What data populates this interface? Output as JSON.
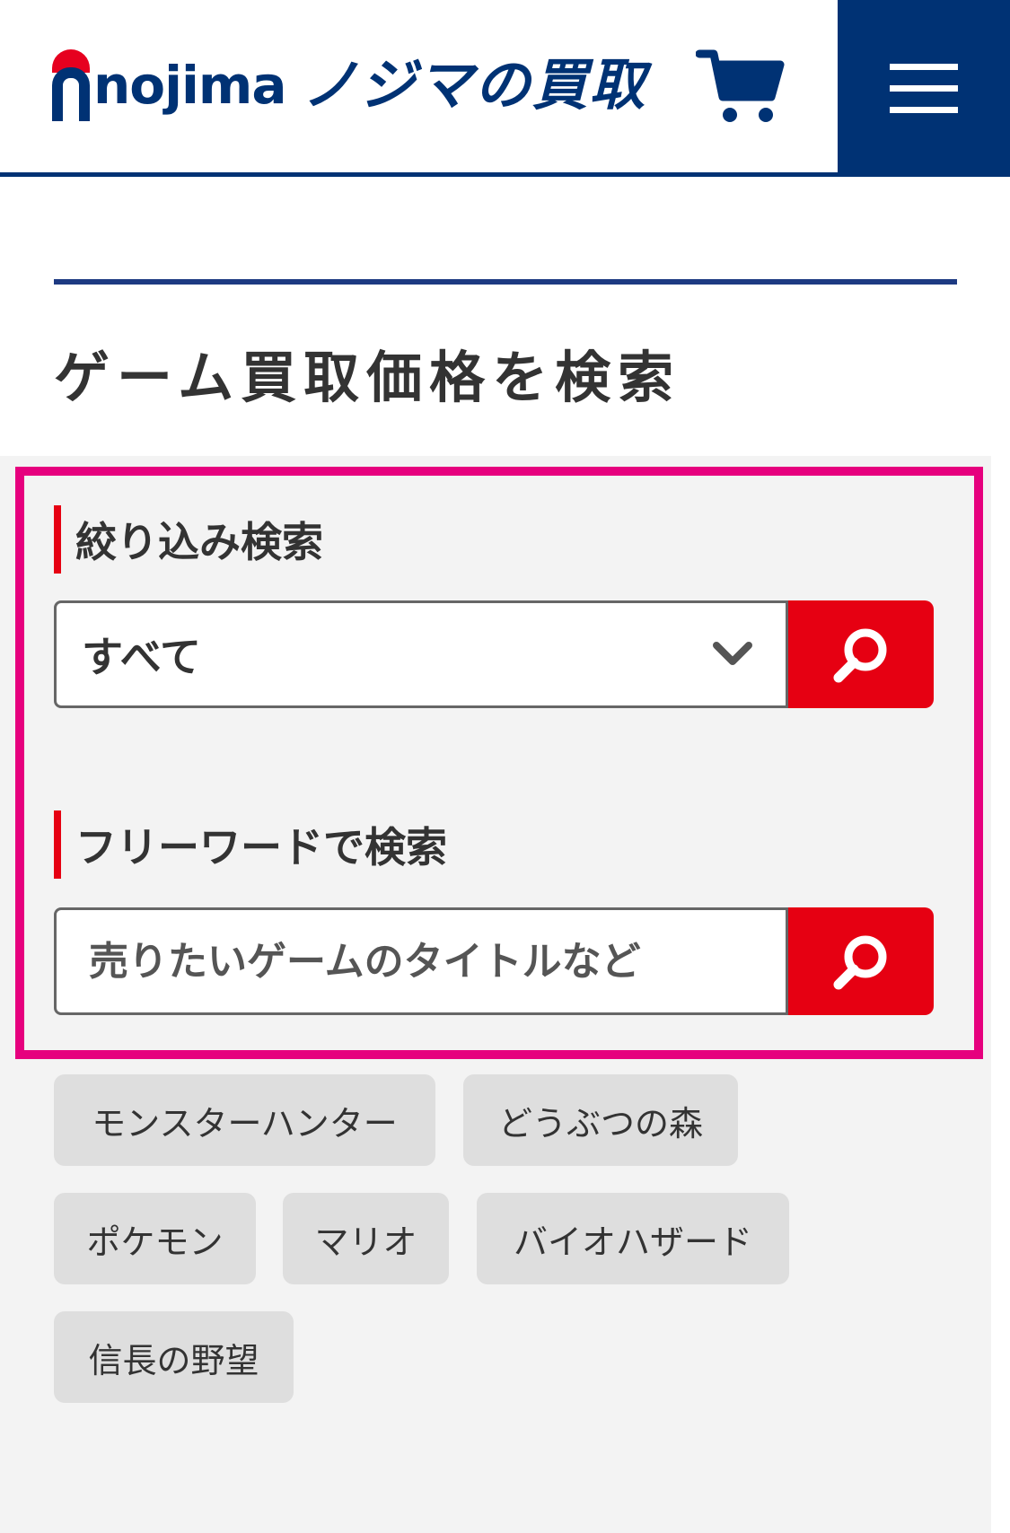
{
  "header": {
    "logo_word": "nojima",
    "logo_sub": "ノジマの買取",
    "cart_icon": "cart-icon",
    "menu_icon": "hamburger-menu-icon"
  },
  "page": {
    "title": "ゲーム買取価格を検索"
  },
  "filter_search": {
    "label": "絞り込み検索",
    "select_value": "すべて",
    "dropdown_icon": "chevron-down-icon",
    "button_icon": "search-icon"
  },
  "freeword_search": {
    "label": "フリーワードで検索",
    "placeholder": "売りたいゲームのタイトルなど",
    "button_icon": "search-icon"
  },
  "popular_tags": [
    "モンスターハンター",
    "どうぶつの森",
    "ポケモン",
    "マリオ",
    "バイオハザード",
    "信長の野望"
  ],
  "colors": {
    "brand_blue": "#003274",
    "accent_red": "#e60012",
    "highlight_pink": "#e6007e"
  }
}
